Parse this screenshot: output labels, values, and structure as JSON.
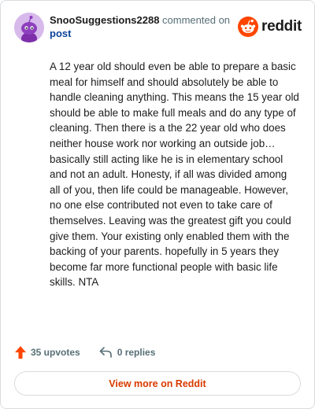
{
  "comment": {
    "username": "SnooSuggestions2288",
    "action_text": "commented on",
    "post_link": "post",
    "avatar_icon": "snoo-avatar-icon",
    "body": "A 12 year old should even be able to prepare a basic meal for himself and should absolutely be able to handle cleaning anything. This means the 15 year old should be able to make full meals and do any type of cleaning. Then there is a the 22 year old who does neither house work nor working an outside job…basically still acting like he is in elementary school and not an adult. Honesty, if all was divided among all of you, then life could be manageable. However, no one else contributed not even to take care of themselves. Leaving was the greatest gift you could give them. Your existing only enabled them with the backing of your parents. hopefully in 5 years they become far more functional people with basic life skills. NTA"
  },
  "brand": {
    "name": "reddit",
    "logo_icon": "reddit-logo-icon",
    "accent_color": "#ff4500"
  },
  "stats": {
    "upvotes": "35 upvotes",
    "replies": "0 replies",
    "upvote_icon": "upvote-arrow-icon",
    "reply_icon": "reply-arrow-icon"
  },
  "actions": {
    "view_more": "View more on Reddit"
  },
  "colors": {
    "avatar_bg": "#d7b9ec",
    "link": "#0a449b",
    "view_more_text": "#d93a00",
    "upvote": "#ff4500"
  }
}
